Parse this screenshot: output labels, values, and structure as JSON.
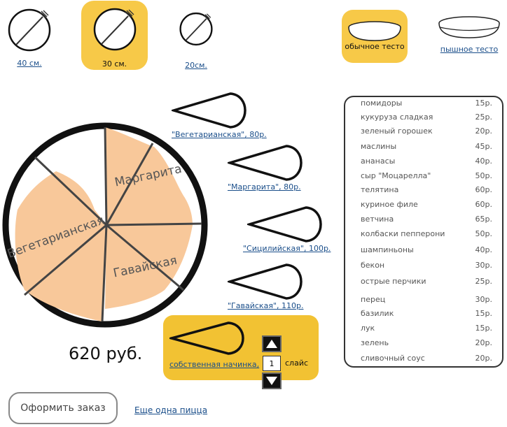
{
  "sizes": [
    {
      "label": "40 см.",
      "selected": false
    },
    {
      "label": "30 см.",
      "selected": true
    },
    {
      "label": "20см.",
      "selected": false
    }
  ],
  "dough": [
    {
      "label": "обычное тесто",
      "selected": true
    },
    {
      "label": "пышное тесто",
      "selected": false
    }
  ],
  "pizza": {
    "slices": [
      "Маргарита",
      "Вегетарианская",
      "Гавайская"
    ],
    "price": "620 руб."
  },
  "slice_options": [
    {
      "label": "\"Вегетарианская\", 80р."
    },
    {
      "label": "\"Маргарита\", 80р."
    },
    {
      "label": "\"Сицилийская\", 100р."
    },
    {
      "label": "\"Гавайская\", 110р."
    }
  ],
  "custom": {
    "label": "собственная начинка,",
    "qty": "1",
    "unit": "слайс"
  },
  "ingredients": [
    {
      "name": "помидоры",
      "price": "15р."
    },
    {
      "name": "кукуруза сладкая",
      "price": "25р."
    },
    {
      "name": "зеленый горошек",
      "price": "20р."
    },
    {
      "name": "маслины",
      "price": "45р."
    },
    {
      "name": "ананасы",
      "price": "40р."
    },
    {
      "name": "сыр \"Моцарелла\"",
      "price": "50р."
    },
    {
      "name": "телятина",
      "price": "60р."
    },
    {
      "name": "куриное филе",
      "price": "60р."
    },
    {
      "name": "ветчина",
      "price": "65р."
    },
    {
      "name": "колбаски пепперони",
      "price": "50р."
    },
    {
      "name": "шампиньоны",
      "price": "40р."
    },
    {
      "name": "бекон",
      "price": "30р."
    },
    {
      "name": "острые перчики",
      "price": "25р."
    },
    {
      "name": "перец",
      "price": "30р."
    },
    {
      "name": "базилик",
      "price": "15р."
    },
    {
      "name": "лук",
      "price": "15р."
    },
    {
      "name": "зелень",
      "price": "20р."
    },
    {
      "name": "сливочный соус",
      "price": "20р."
    }
  ],
  "actions": {
    "order": "Оформить заказ",
    "another": "Еще одна пицца"
  },
  "colors": {
    "accent": "#f2c233",
    "crust_fill": "#f8c89a",
    "link": "#1a4e8a"
  }
}
